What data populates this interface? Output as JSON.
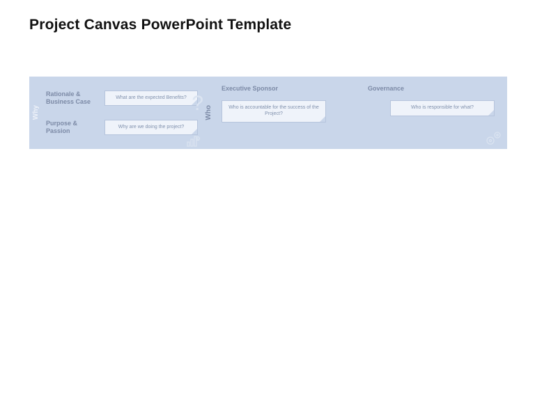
{
  "title": "Project Canvas PowerPoint Template",
  "band": {
    "why": {
      "tab": "Why",
      "rows": [
        {
          "label": "Rationale & Business Case",
          "note": "What are the expected Benefits?"
        },
        {
          "label": "Purpose & Passion",
          "note": "Why are we doing the project?"
        }
      ]
    },
    "who": {
      "tab": "Who",
      "cols": [
        {
          "header": "Executive Sponsor",
          "note": "Who is accountable for the success of the Project?"
        },
        {
          "header": "Governance",
          "note": "Who is responsible for what?"
        }
      ]
    }
  }
}
